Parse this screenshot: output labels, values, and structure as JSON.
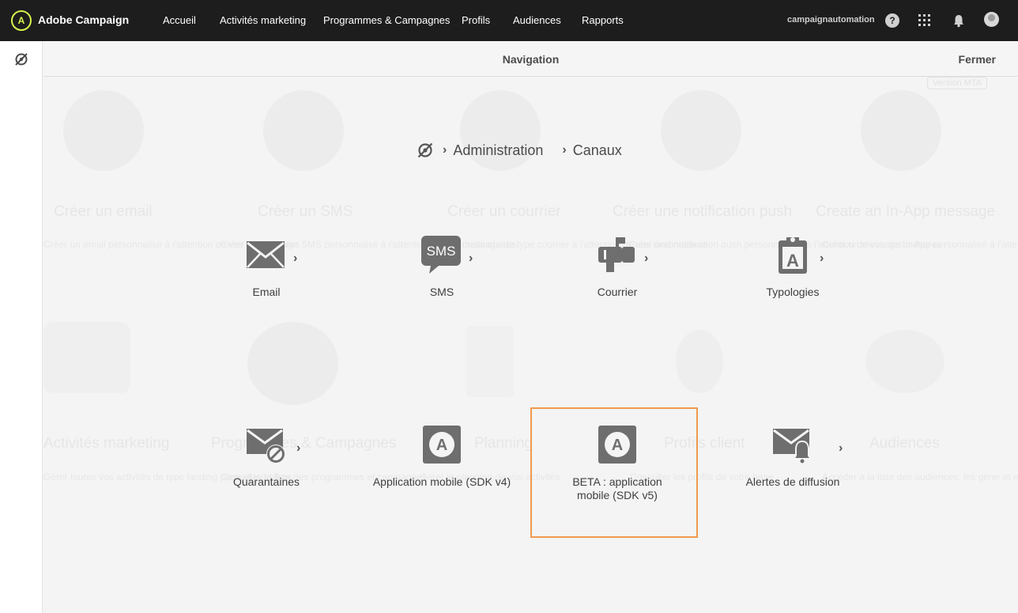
{
  "topbar": {
    "app_title": "Adobe Campaign",
    "nav": [
      "Accueil",
      "Activités marketing",
      "Programmes & Campagnes",
      "Profils",
      "Audiences",
      "Rapports"
    ],
    "account": "campaignautomation",
    "help_glyph": "?"
  },
  "navigation": {
    "title": "Navigation",
    "close_label": "Fermer"
  },
  "breadcrumb": {
    "items": [
      "Administration",
      "Canaux"
    ]
  },
  "tiles": [
    {
      "label": "Email",
      "icon": "envelope-icon"
    },
    {
      "label": "SMS",
      "icon": "sms-bubble-icon",
      "icon_text": "SMS"
    },
    {
      "label": "Courrier",
      "icon": "mailbox-icon"
    },
    {
      "label": "Typologies",
      "icon": "typology-clipboard-icon",
      "icon_text": "A"
    },
    {
      "label": "Quarantaines",
      "icon": "envelope-blocked-icon"
    },
    {
      "label": "Application mobile (SDK v4)",
      "icon": "app-icon",
      "icon_text": "A"
    },
    {
      "label": "BETA : application mobile (SDK v5)",
      "icon": "app-icon",
      "icon_text": "A"
    },
    {
      "label": "Alertes de diffusion",
      "icon": "envelope-bell-icon"
    }
  ],
  "background": {
    "badge": "Version MTA",
    "titles": [
      "Créer un email",
      "Créer un SMS",
      "Créer un courrier",
      "Créer une notification push",
      "Create an In-App message",
      "Activités marketing",
      "Programmes & Campagnes",
      "Planning",
      "Profils client",
      "Audiences"
    ],
    "descriptions": [
      "Créer un email personnalisé à l'attention de vos destinataires",
      "Créer un message SMS personnalisé à l'attention de vos destinataires",
      "Créer un message de type courrier à l'attention de vos destinataires",
      "Créer une notification push personnalisée à l'attention de vos destinataires",
      "Créer un message In-App personnalisé à l'attention de vos destinataires",
      "Gérer toutes vos activités de type landing page et workflow",
      "Consulter la liste des programmes et campagnes",
      "Gérer le planning de vos activités",
      "Consulter les profils de votre base",
      "Accéder à la liste des audiences, les gérer et en créer de nouvelles"
    ]
  },
  "colors": {
    "topbar_bg": "#1d1d1d",
    "logo_accent": "#d7f24b",
    "highlight": "#f09a4f",
    "icon_gray": "#6e6e6e"
  }
}
